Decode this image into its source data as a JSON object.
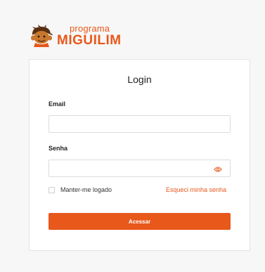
{
  "brand": {
    "line1": "programa",
    "line2": "MIGUILIM",
    "color": "#e8581b",
    "icon": "boy-mascot-icon"
  },
  "login": {
    "title": "Login",
    "email_label": "Email",
    "email_value": "",
    "password_label": "Senha",
    "password_value": "",
    "toggle_icon": "eye-icon",
    "remember_label": "Manter-me logado",
    "remember_checked": false,
    "forgot_link": "Esqueci minha senha",
    "submit_label": "Acessar"
  }
}
